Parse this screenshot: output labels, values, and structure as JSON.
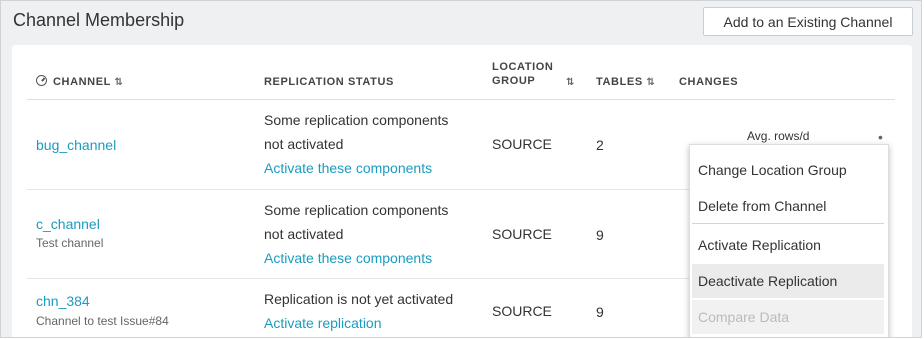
{
  "panel": {
    "title": "Channel Membership",
    "add_button_label": "Add to an Existing Channel"
  },
  "table": {
    "headers": {
      "channel": "CHANNEL",
      "replication_status": "REPLICATION STATUS",
      "location_group_line1": "LOCATION",
      "location_group_line2": "GROUP",
      "tables": "TABLES",
      "changes": "CHANGES",
      "sort_glyph": "⇅"
    },
    "rows": [
      {
        "channel": "bug_channel",
        "description": "",
        "status_line1": "Some replication components",
        "status_line2": "not activated",
        "action": "Activate these components",
        "location_group": "SOURCE",
        "tables": "2",
        "changes": "Avg. rows/d"
      },
      {
        "channel": "c_channel",
        "description": "Test channel",
        "status_line1": "Some replication components",
        "status_line2": "not activated",
        "action": "Activate these components",
        "location_group": "SOURCE",
        "tables": "9",
        "changes": ""
      },
      {
        "channel": "chn_384",
        "description": "Channel to test Issue#84",
        "status_line1": "Replication is not yet activated",
        "status_line2": "",
        "action": "Activate replication",
        "location_group": "SOURCE",
        "tables": "9",
        "changes": ""
      }
    ]
  },
  "context_menu": {
    "items": [
      {
        "label": "Change Location Group",
        "state": "normal"
      },
      {
        "label": "Delete from Channel",
        "state": "normal"
      },
      {
        "label": "Activate Replication",
        "state": "normal"
      },
      {
        "label": "Deactivate Replication",
        "state": "hover"
      },
      {
        "label": "Compare Data",
        "state": "disabled"
      }
    ]
  },
  "colors": {
    "link": "#1a9cc0",
    "panel_bg": "#eef0f1",
    "menu_hover": "#ebebeb",
    "disabled_text": "#b7bcc0"
  },
  "icons": {
    "channel_header_icon": "gauge-icon",
    "row_menu_icon": "kebab-menu-icon"
  }
}
